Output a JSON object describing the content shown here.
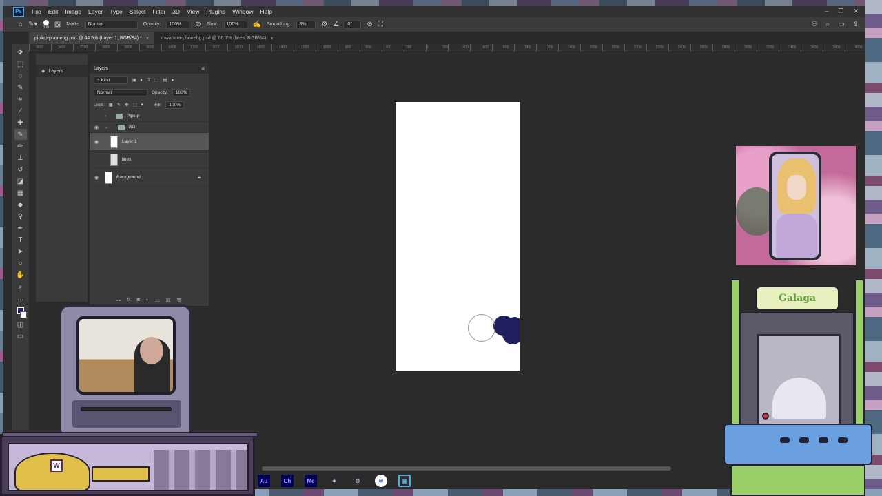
{
  "menu": {
    "logo": "Ps",
    "items": [
      "File",
      "Edit",
      "Image",
      "Layer",
      "Type",
      "Select",
      "Filter",
      "3D",
      "View",
      "Plugins",
      "Window",
      "Help"
    ]
  },
  "options": {
    "brush_size": "300",
    "mode_label": "Mode:",
    "mode_value": "Normal",
    "opacity_label": "Opacity:",
    "opacity_value": "100%",
    "flow_label": "Flow:",
    "flow_value": "100%",
    "smoothing_label": "Smoothing:",
    "smoothing_value": "8%",
    "angle_value": "0°"
  },
  "tabs": [
    {
      "label": "piplup-phonebg.psd @ 44.5% (Layer 1, RGB/8#) *"
    },
    {
      "label": "kuwabara-phonebg.psd @ 66.7% (lines, RGB/8#)"
    }
  ],
  "ruler": {
    "ticks": [
      "3600",
      "3400",
      "3200",
      "3000",
      "2800",
      "2600",
      "2400",
      "2200",
      "2000",
      "1800",
      "1600",
      "1400",
      "1200",
      "1000",
      "800",
      "600",
      "400",
      "200",
      "0",
      "200",
      "400",
      "600",
      "800",
      "1000",
      "1200",
      "1400",
      "1600",
      "1800",
      "2000",
      "2200",
      "2400",
      "2600",
      "2800",
      "3000",
      "3200",
      "3400",
      "3600",
      "3800",
      "4000"
    ]
  },
  "dock": {
    "layers_tab": "Layers"
  },
  "layers_panel": {
    "title": "Layers",
    "filter_kind": "Kind",
    "blend_mode": "Normal",
    "opacity_label": "Opacity:",
    "opacity_value": "100%",
    "lock_label": "Lock:",
    "fill_label": "Fill:",
    "fill_value": "100%",
    "layers": {
      "piplup": "Piplup",
      "bg": "BG",
      "layer1": "Layer 1",
      "lines": "lines",
      "background": "Background"
    }
  },
  "taskbar": {
    "audition": "Au",
    "character": "Ch",
    "media_encoder": "Me"
  },
  "overlay": {
    "shelf_logo": "W",
    "arcade_marquee": "Galaga"
  },
  "colors": {
    "accent": "#31a8ff",
    "foreground_swatch": "#22225e",
    "background_swatch": "#ffffff",
    "canvas": "#ffffff",
    "brush_stroke": "#1e1f5c"
  }
}
